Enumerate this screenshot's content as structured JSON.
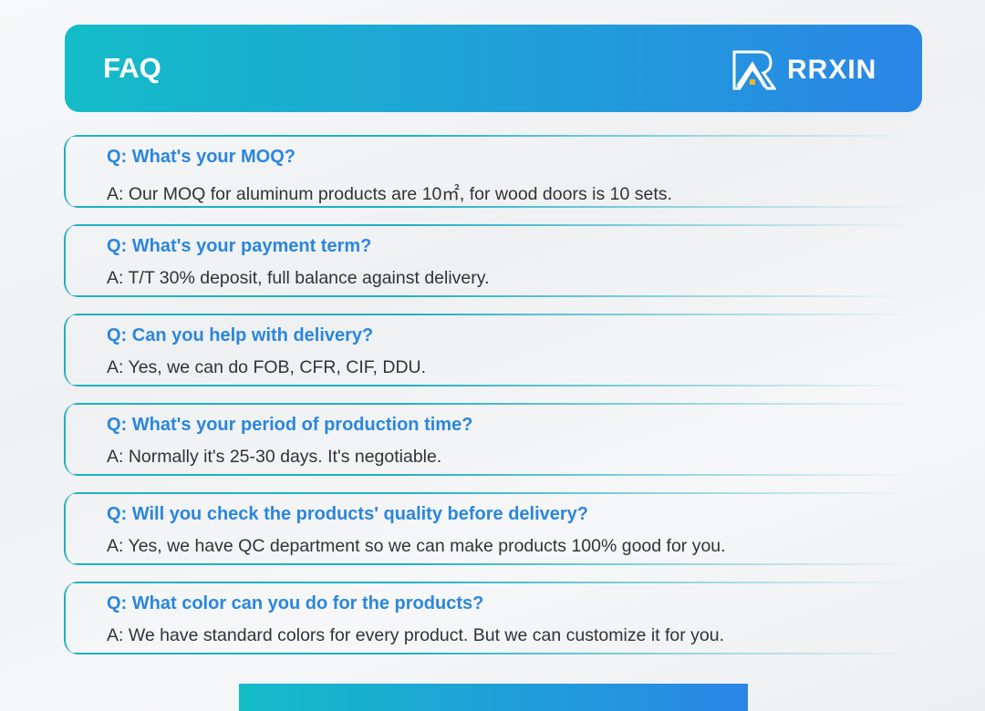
{
  "header": {
    "title": "FAQ",
    "brand": "RRXIN"
  },
  "faq": [
    {
      "q": "Q: What's your MOQ?",
      "a": "A: Our MOQ for aluminum products are 10㎡, for wood doors is 10 sets."
    },
    {
      "q": "Q: What's your payment term?",
      "a": "A: T/T 30% deposit, full balance against delivery."
    },
    {
      "q": "Q: Can you help with delivery?",
      "a": "A: Yes, we can do FOB, CFR, CIF, DDU."
    },
    {
      "q": "Q: What's your period of production time?",
      "a": "A: Normally it's 25-30 days. It's negotiable."
    },
    {
      "q": "Q: Will you check the products' quality before delivery?",
      "a": "A: Yes, we have QC department so we can make products 100% good for you."
    },
    {
      "q": "Q: What color can you do for the products?",
      "a": "A: We have standard colors for every product. But we can customize it for you."
    }
  ]
}
